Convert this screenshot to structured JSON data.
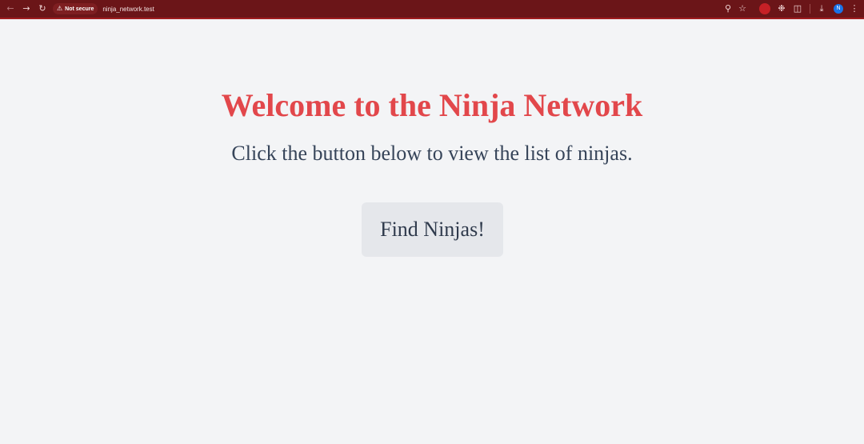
{
  "browser": {
    "security_label": "Not secure",
    "url": "ninja_network.test",
    "profile_initial": "N",
    "icons": {
      "back": "back-arrow-icon",
      "forward": "forward-arrow-icon",
      "reload": "reload-icon",
      "warning": "warning-triangle-icon",
      "zoom": "zoom-icon",
      "bookmark": "star-icon",
      "extension_a": "extension-record-icon",
      "extension_b": "extension-gear-icon",
      "extensions": "puzzle-icon",
      "download": "download-icon",
      "menu": "kebab-menu-icon"
    },
    "colors": {
      "toolbar": "#6b1518",
      "toolbar_accent": "#a01c1f"
    }
  },
  "page": {
    "title": "Welcome to the Ninja Network",
    "subtitle": "Click the button below to view the list of ninjas.",
    "button_label": "Find Ninjas!",
    "colors": {
      "background": "#f3f4f6",
      "title": "#e2474b",
      "subtitle": "#364459",
      "button_bg": "#e5e7eb"
    }
  }
}
